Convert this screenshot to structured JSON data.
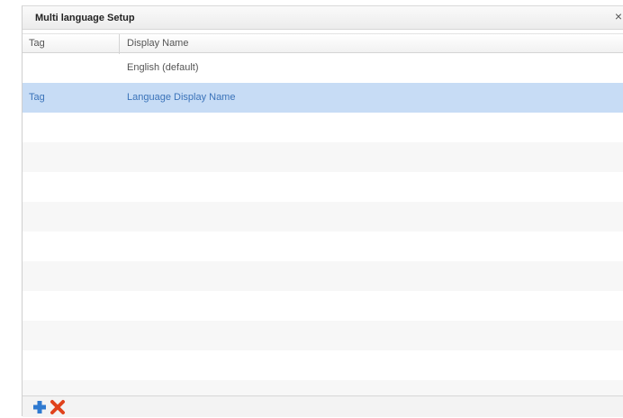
{
  "dialog": {
    "title": "Multi language Setup",
    "close_label": "×"
  },
  "table": {
    "columns": [
      "Tag",
      "Display Name"
    ],
    "rows": [
      {
        "tag": "",
        "display_name": "English (default)",
        "selected": false
      },
      {
        "tag": "Tag",
        "display_name": "Language Display Name",
        "selected": true
      }
    ]
  },
  "toolbar": {
    "buttons": [
      {
        "icon": "plus-icon",
        "color": "#2f7ad0"
      },
      {
        "icon": "red-x-icon",
        "color": "#e0421c"
      }
    ]
  },
  "colors": {
    "selection": "#c7dcf5",
    "selection_text": "#3b73b9"
  }
}
